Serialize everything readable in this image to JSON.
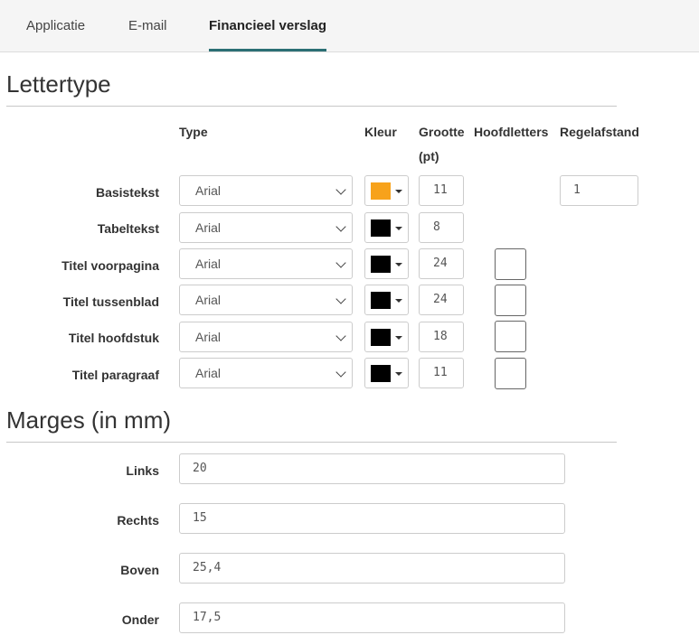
{
  "tabs": [
    "Applicatie",
    "E-mail",
    "Financieel verslag"
  ],
  "font_section": {
    "title": "Lettertype",
    "columns": {
      "type": "Type",
      "color": "Kleur",
      "size": "Grootte (pt)",
      "caps": "Hoofdletters",
      "spacing": "Regelafstand"
    },
    "rows": [
      {
        "label": "Basistekst",
        "font": "Arial",
        "color": "#f7a21b",
        "size": "11",
        "spacing": "1"
      },
      {
        "label": "Tabeltekst",
        "font": "Arial",
        "color": "#000000",
        "size": "8"
      },
      {
        "label": "Titel voorpagina",
        "font": "Arial",
        "color": "#000000",
        "size": "24",
        "caps": false
      },
      {
        "label": "Titel tussenblad",
        "font": "Arial",
        "color": "#000000",
        "size": "24",
        "caps": false
      },
      {
        "label": "Titel hoofdstuk",
        "font": "Arial",
        "color": "#000000",
        "size": "18",
        "caps": false
      },
      {
        "label": "Titel paragraaf",
        "font": "Arial",
        "color": "#000000",
        "size": "11",
        "caps": false
      }
    ]
  },
  "margins_section": {
    "title": "Marges (in mm)",
    "fields": [
      {
        "label": "Links",
        "value": "20"
      },
      {
        "label": "Rechts",
        "value": "15"
      },
      {
        "label": "Boven",
        "value": "25,4"
      },
      {
        "label": "Onder",
        "value": "17,5"
      }
    ]
  },
  "colors": {
    "tab_active_underline": "#2b6f74"
  }
}
